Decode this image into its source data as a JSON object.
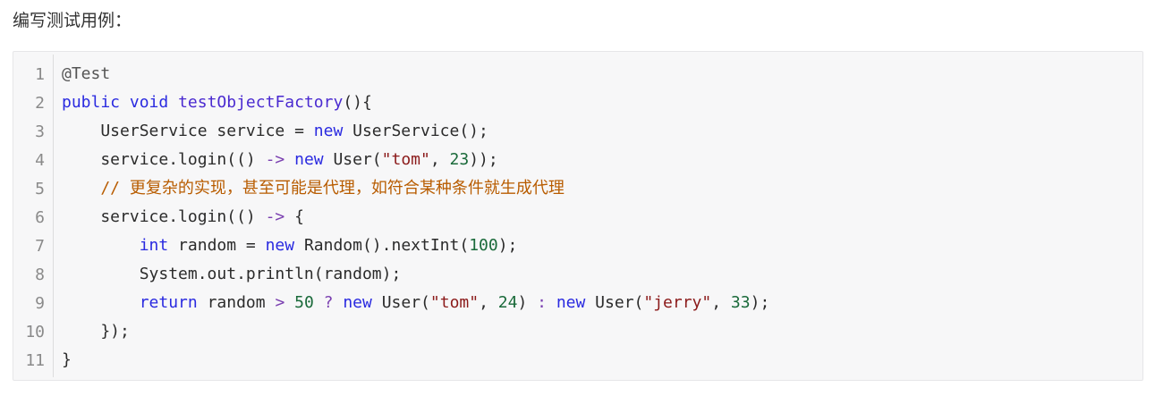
{
  "heading": "编写测试用例：",
  "code": {
    "line_numbers": [
      "1",
      "2",
      "3",
      "4",
      "5",
      "6",
      "7",
      "8",
      "9",
      "10",
      "11"
    ],
    "lines": [
      [
        {
          "t": "@Test",
          "c": "ann"
        }
      ],
      [
        {
          "t": "public",
          "c": "kw"
        },
        {
          "t": " ",
          "c": ""
        },
        {
          "t": "void",
          "c": "kw"
        },
        {
          "t": " ",
          "c": ""
        },
        {
          "t": "testObjectFactory",
          "c": "fn"
        },
        {
          "t": "(){",
          "c": ""
        }
      ],
      [
        {
          "t": "    UserService service = ",
          "c": ""
        },
        {
          "t": "new",
          "c": "kw"
        },
        {
          "t": " UserService();",
          "c": ""
        }
      ],
      [
        {
          "t": "    service.login(() ",
          "c": ""
        },
        {
          "t": "->",
          "c": "op"
        },
        {
          "t": " ",
          "c": ""
        },
        {
          "t": "new",
          "c": "kw"
        },
        {
          "t": " User(",
          "c": ""
        },
        {
          "t": "\"tom\"",
          "c": "str"
        },
        {
          "t": ", ",
          "c": ""
        },
        {
          "t": "23",
          "c": "num"
        },
        {
          "t": "));",
          "c": ""
        }
      ],
      [
        {
          "t": "    // 更复杂的实现，甚至可能是代理，如符合某种条件就生成代理",
          "c": "cm"
        }
      ],
      [
        {
          "t": "    service.login(() ",
          "c": ""
        },
        {
          "t": "->",
          "c": "op"
        },
        {
          "t": " {",
          "c": ""
        }
      ],
      [
        {
          "t": "        ",
          "c": ""
        },
        {
          "t": "int",
          "c": "ty"
        },
        {
          "t": " random = ",
          "c": ""
        },
        {
          "t": "new",
          "c": "kw"
        },
        {
          "t": " Random().nextInt(",
          "c": ""
        },
        {
          "t": "100",
          "c": "num"
        },
        {
          "t": ");",
          "c": ""
        }
      ],
      [
        {
          "t": "        System.out.println(random);",
          "c": ""
        }
      ],
      [
        {
          "t": "        ",
          "c": ""
        },
        {
          "t": "return",
          "c": "kw"
        },
        {
          "t": " random ",
          "c": ""
        },
        {
          "t": ">",
          "c": "op"
        },
        {
          "t": " ",
          "c": ""
        },
        {
          "t": "50",
          "c": "num"
        },
        {
          "t": " ",
          "c": ""
        },
        {
          "t": "?",
          "c": "op"
        },
        {
          "t": " ",
          "c": ""
        },
        {
          "t": "new",
          "c": "kw"
        },
        {
          "t": " User(",
          "c": ""
        },
        {
          "t": "\"tom\"",
          "c": "str"
        },
        {
          "t": ", ",
          "c": ""
        },
        {
          "t": "24",
          "c": "num"
        },
        {
          "t": ") ",
          "c": ""
        },
        {
          "t": ":",
          "c": "op"
        },
        {
          "t": " ",
          "c": ""
        },
        {
          "t": "new",
          "c": "kw"
        },
        {
          "t": " User(",
          "c": ""
        },
        {
          "t": "\"jerry\"",
          "c": "str"
        },
        {
          "t": ", ",
          "c": ""
        },
        {
          "t": "33",
          "c": "num"
        },
        {
          "t": ");",
          "c": ""
        }
      ],
      [
        {
          "t": "    });",
          "c": ""
        }
      ],
      [
        {
          "t": "}",
          "c": ""
        }
      ]
    ]
  }
}
